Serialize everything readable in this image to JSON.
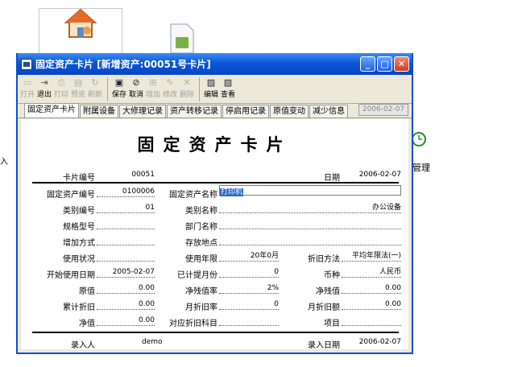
{
  "desktop": {
    "left_text": "入",
    "right_text": "管理"
  },
  "window": {
    "title": "固定资产卡片 [新增资产:00051号卡片]",
    "toolbar": [
      {
        "label": "打开",
        "icon": "open-icon",
        "enabled": false
      },
      {
        "label": "退出",
        "icon": "exit-icon",
        "enabled": true
      },
      {
        "label": "打印",
        "icon": "print-icon",
        "enabled": false
      },
      {
        "label": "预览",
        "icon": "preview-icon",
        "enabled": false
      },
      {
        "label": "刷新",
        "icon": "refresh-icon",
        "enabled": false
      },
      {
        "label": "保存",
        "icon": "save-icon",
        "enabled": true
      },
      {
        "label": "取消",
        "icon": "cancel-icon",
        "enabled": true
      },
      {
        "label": "增加",
        "icon": "add-icon",
        "enabled": false
      },
      {
        "label": "修改",
        "icon": "edit-icon",
        "enabled": false
      },
      {
        "label": "删除",
        "icon": "delete-icon",
        "enabled": false
      },
      {
        "label": "编辑",
        "icon": "compile-icon",
        "enabled": true
      },
      {
        "label": "查看",
        "icon": "view-icon",
        "enabled": true
      }
    ],
    "tabs": [
      "固定资产卡片",
      "附属设备",
      "大修理记录",
      "资产转移记录",
      "停启用记录",
      "原值变动",
      "减少信息"
    ],
    "tab_date": "2006-02-07"
  },
  "card": {
    "title": "固定资产卡片",
    "card_no_label": "卡片编号",
    "card_no": "00051",
    "date_label": "日期",
    "date": "2006-02-07",
    "asset_code_label": "固定资产编号",
    "asset_code": "0100006",
    "asset_name_label": "固定资产名称",
    "asset_name": "打印机",
    "cat_code_label": "类别编号",
    "cat_code": "01",
    "cat_name_label": "类别名称",
    "cat_name": "办公设备",
    "spec_label": "规格型号",
    "dept_label": "部门名称",
    "add_label": "增加方式",
    "location_label": "存放地点",
    "status_label": "使用状况",
    "life_label": "使用年限",
    "life": "20年0月",
    "method_label": "折旧方法",
    "method": "平均年限法(一)",
    "start_label": "开始使用日期",
    "start": "2005-02-07",
    "months_label": "已计提月份",
    "months": "0",
    "currency_label": "币种",
    "currency": "人民币",
    "orig_label": "原值",
    "orig": "0.00",
    "salvage_rate_label": "净残值率",
    "salvage_rate": "2%",
    "salvage_label": "净残值",
    "salvage": "0.00",
    "accum_label": "累计折旧",
    "accum": "0.00",
    "month_rate_label": "月折旧率",
    "month_rate": "0",
    "month_amt_label": "月折旧额",
    "month_amt": "0.00",
    "net_label": "净值",
    "net": "0.00",
    "subject_label": "对应折旧科目",
    "item_label": "项目",
    "entry_label": "录入人",
    "entry": "demo",
    "entry_date_label": "录入日期",
    "entry_date": "2006-02-07"
  }
}
